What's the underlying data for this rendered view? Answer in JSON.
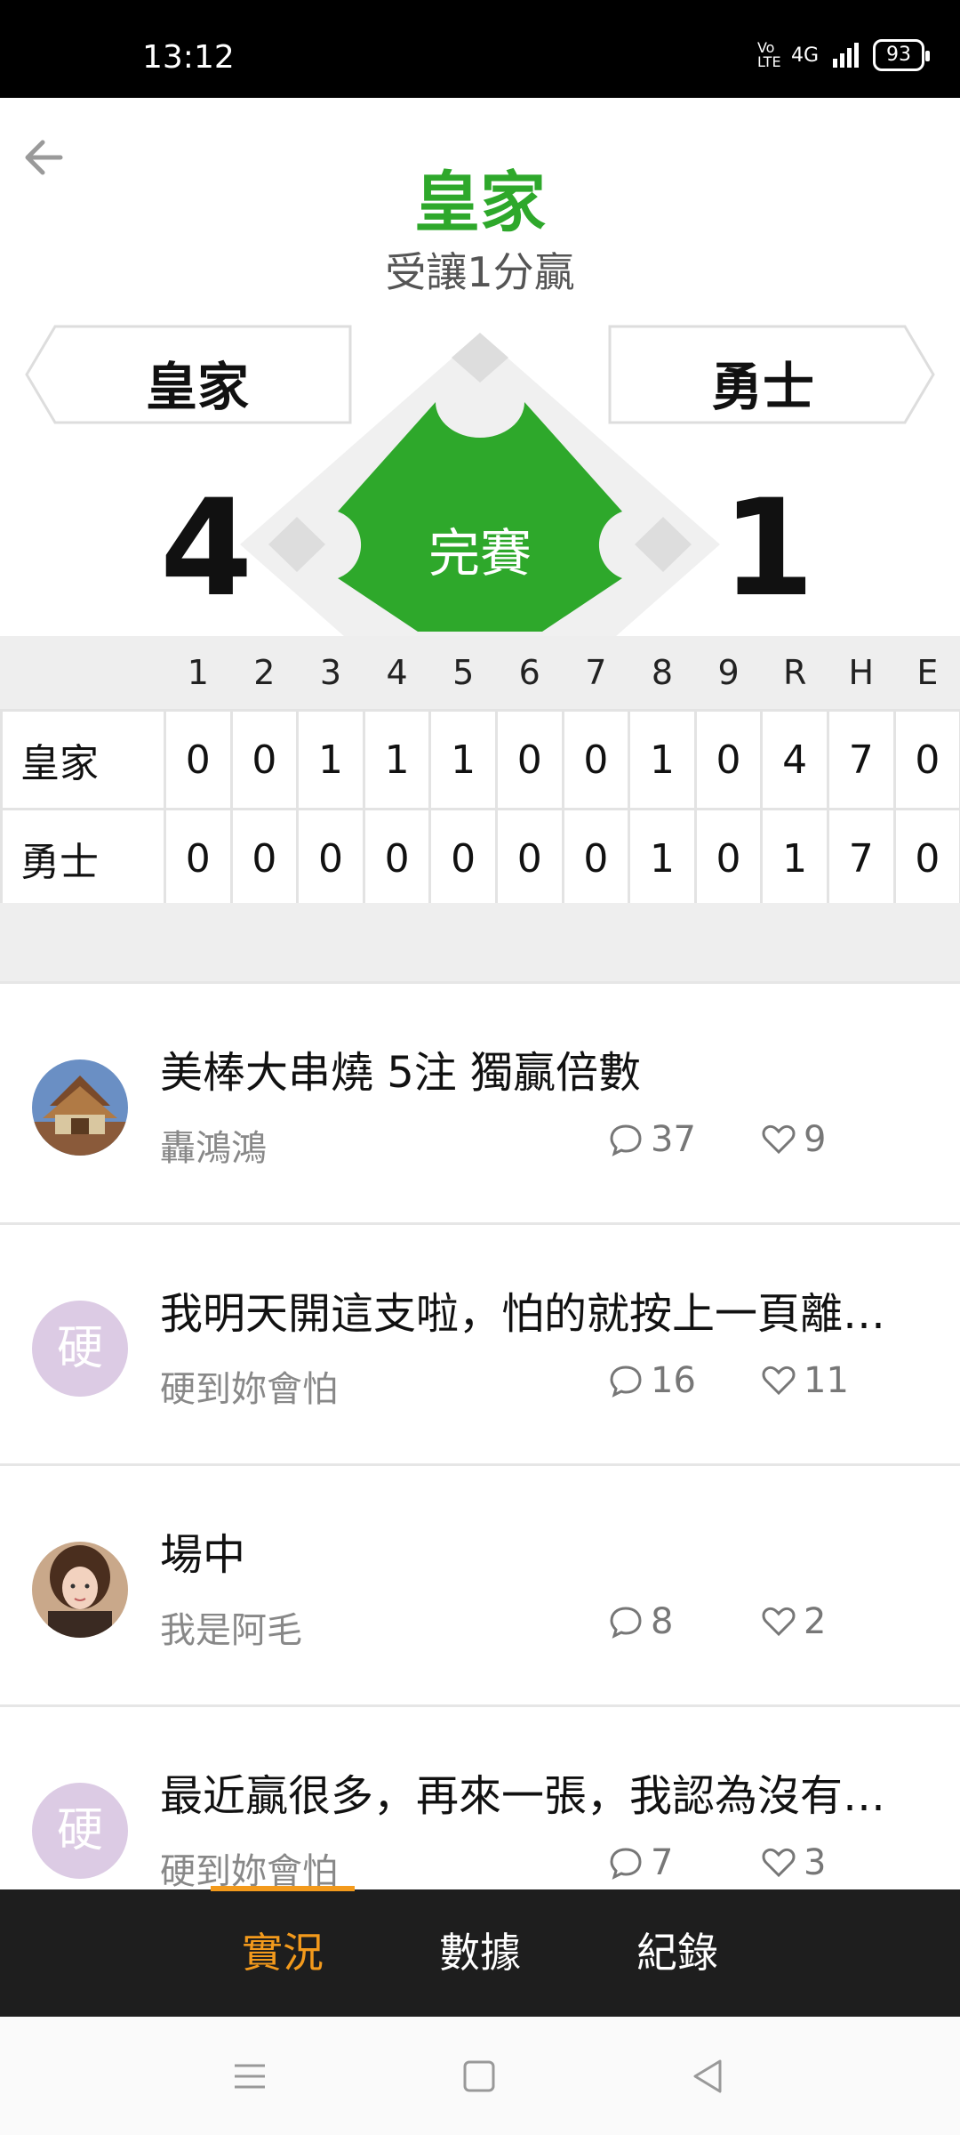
{
  "status_bar": {
    "time": "13:12",
    "network": "4G",
    "volte": "Vo LTE",
    "battery": "93"
  },
  "header": {
    "title": "皇家",
    "subtitle": "受讓1分贏"
  },
  "game": {
    "away_team": "皇家",
    "home_team": "勇士",
    "away_score": "4",
    "home_score": "1",
    "status": "完賽"
  },
  "linescore": {
    "columns": [
      "1",
      "2",
      "3",
      "4",
      "5",
      "6",
      "7",
      "8",
      "9",
      "R",
      "H",
      "E"
    ],
    "rows": [
      {
        "team": "皇家",
        "values": [
          "0",
          "0",
          "1",
          "1",
          "1",
          "0",
          "0",
          "1",
          "0",
          "4",
          "7",
          "0"
        ]
      },
      {
        "team": "勇士",
        "values": [
          "0",
          "0",
          "0",
          "0",
          "0",
          "0",
          "0",
          "1",
          "0",
          "1",
          "7",
          "0"
        ]
      }
    ]
  },
  "posts": [
    {
      "title": "美棒大串燒 5注 獨贏倍數",
      "author": "轟鴻鴻",
      "comments": "37",
      "likes": "9",
      "avatar_letter": "",
      "avatar_icon": "temple-photo"
    },
    {
      "title": "我明天開這支啦，怕的就按上一頁離開...",
      "author": "硬到妳會怕",
      "comments": "16",
      "likes": "11",
      "avatar_letter": "硬",
      "avatar_icon": ""
    },
    {
      "title": "場中",
      "author": "我是阿毛",
      "comments": "8",
      "likes": "2",
      "avatar_letter": "",
      "avatar_icon": "girl-photo"
    },
    {
      "title": "最近贏很多，再來一張，我認為沒有塞...",
      "author": "硬到妳會怕",
      "comments": "7",
      "likes": "3",
      "avatar_letter": "硬",
      "avatar_icon": ""
    }
  ],
  "tabs": [
    {
      "label": "實況",
      "active": true
    },
    {
      "label": "數據",
      "active": false
    },
    {
      "label": "紀錄",
      "active": false
    }
  ],
  "colors": {
    "accent_green": "#2ea82b",
    "accent_orange": "#f39a1c",
    "tabbar_bg": "#1e1e1e"
  }
}
